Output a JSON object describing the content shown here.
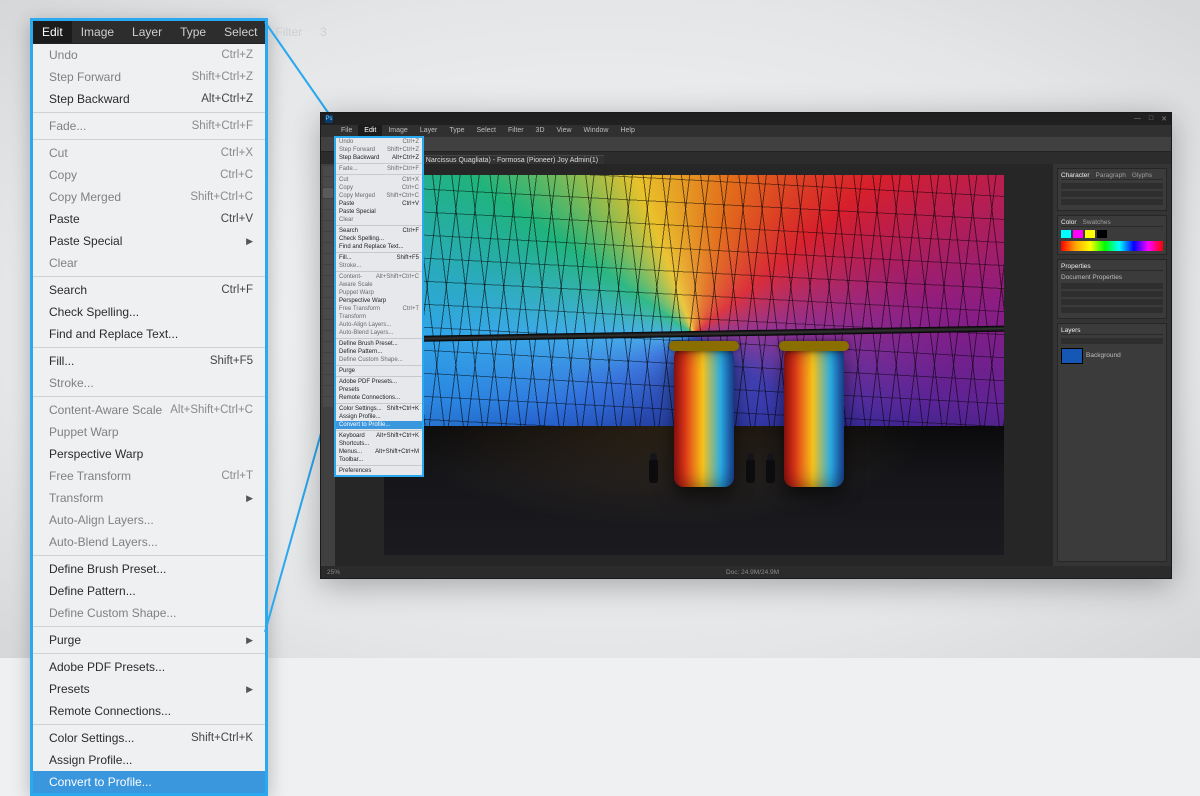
{
  "zoom_menubar": [
    "Edit",
    "Image",
    "Layer",
    "Type",
    "Select",
    "Filter",
    "3"
  ],
  "zoom_menu_active": 0,
  "menu_groups": [
    [
      {
        "label": "Undo",
        "shortcut": "Ctrl+Z",
        "enabled": false
      },
      {
        "label": "Step Forward",
        "shortcut": "Shift+Ctrl+Z",
        "enabled": false
      },
      {
        "label": "Step Backward",
        "shortcut": "Alt+Ctrl+Z",
        "enabled": true
      }
    ],
    [
      {
        "label": "Fade...",
        "shortcut": "Shift+Ctrl+F",
        "enabled": false
      }
    ],
    [
      {
        "label": "Cut",
        "shortcut": "Ctrl+X",
        "enabled": false
      },
      {
        "label": "Copy",
        "shortcut": "Ctrl+C",
        "enabled": false
      },
      {
        "label": "Copy Merged",
        "shortcut": "Shift+Ctrl+C",
        "enabled": false
      },
      {
        "label": "Paste",
        "shortcut": "Ctrl+V",
        "enabled": true
      },
      {
        "label": "Paste Special",
        "submenu": true,
        "enabled": true
      },
      {
        "label": "Clear",
        "enabled": false
      }
    ],
    [
      {
        "label": "Search",
        "shortcut": "Ctrl+F",
        "enabled": true
      },
      {
        "label": "Check Spelling...",
        "enabled": true
      },
      {
        "label": "Find and Replace Text...",
        "enabled": true
      }
    ],
    [
      {
        "label": "Fill...",
        "shortcut": "Shift+F5",
        "enabled": true
      },
      {
        "label": "Stroke...",
        "enabled": false
      }
    ],
    [
      {
        "label": "Content-Aware Scale",
        "shortcut": "Alt+Shift+Ctrl+C",
        "enabled": false
      },
      {
        "label": "Puppet Warp",
        "enabled": false
      },
      {
        "label": "Perspective Warp",
        "enabled": true
      },
      {
        "label": "Free Transform",
        "shortcut": "Ctrl+T",
        "enabled": false
      },
      {
        "label": "Transform",
        "submenu": true,
        "enabled": false
      },
      {
        "label": "Auto-Align Layers...",
        "enabled": false
      },
      {
        "label": "Auto-Blend Layers...",
        "enabled": false
      }
    ],
    [
      {
        "label": "Define Brush Preset...",
        "enabled": true
      },
      {
        "label": "Define Pattern...",
        "enabled": true
      },
      {
        "label": "Define Custom Shape...",
        "enabled": false
      }
    ],
    [
      {
        "label": "Purge",
        "submenu": true,
        "enabled": true
      }
    ],
    [
      {
        "label": "Adobe PDF Presets...",
        "enabled": true
      },
      {
        "label": "Presets",
        "submenu": true,
        "enabled": true
      },
      {
        "label": "Remote Connections...",
        "enabled": true
      }
    ],
    [
      {
        "label": "Color Settings...",
        "shortcut": "Shift+Ctrl+K",
        "enabled": true
      },
      {
        "label": "Assign Profile...",
        "enabled": true
      },
      {
        "label": "Convert to Profile...",
        "enabled": true,
        "highlight": true
      }
    ]
  ],
  "ps": {
    "menubar": [
      "File",
      "Edit",
      "Image",
      "Layer",
      "Type",
      "Select",
      "Filter",
      "3D",
      "View",
      "Window",
      "Help"
    ],
    "open_menu_index": 1,
    "document_tab": "Dome of Light (Glass artist Narcissus Quagliata) - Formosa (Pioneer) Joy Admin(1)",
    "status_left": "25%",
    "status_center": "Doc: 24.9M/24.9M",
    "panels": {
      "color_tabs": [
        "Character",
        "Paragraph",
        "Glyphs"
      ],
      "swatch_tabs": [
        "Color",
        "Swatches"
      ],
      "prop_tabs": [
        "Properties"
      ],
      "prop_title": "Document Properties",
      "layers_tabs": [
        "Layers"
      ],
      "layer_name": "Background"
    },
    "small_menu_groups": [
      [
        {
          "label": "Undo",
          "shortcut": "Ctrl+Z",
          "enabled": false
        },
        {
          "label": "Step Forward",
          "shortcut": "Shift+Ctrl+Z",
          "enabled": false
        },
        {
          "label": "Step Backward",
          "shortcut": "Alt+Ctrl+Z",
          "enabled": true
        }
      ],
      [
        {
          "label": "Fade...",
          "shortcut": "Shift+Ctrl+F",
          "enabled": false
        }
      ],
      [
        {
          "label": "Cut",
          "shortcut": "Ctrl+X",
          "enabled": false
        },
        {
          "label": "Copy",
          "shortcut": "Ctrl+C",
          "enabled": false
        },
        {
          "label": "Copy Merged",
          "shortcut": "Shift+Ctrl+C",
          "enabled": false
        },
        {
          "label": "Paste",
          "shortcut": "Ctrl+V",
          "enabled": true
        },
        {
          "label": "Paste Special",
          "enabled": true
        },
        {
          "label": "Clear",
          "enabled": false
        }
      ],
      [
        {
          "label": "Search",
          "shortcut": "Ctrl+F",
          "enabled": true
        },
        {
          "label": "Check Spelling...",
          "enabled": true
        },
        {
          "label": "Find and Replace Text...",
          "enabled": true
        }
      ],
      [
        {
          "label": "Fill...",
          "shortcut": "Shift+F5",
          "enabled": true
        },
        {
          "label": "Stroke...",
          "enabled": false
        }
      ],
      [
        {
          "label": "Content-Aware Scale",
          "shortcut": "Alt+Shift+Ctrl+C",
          "enabled": false
        },
        {
          "label": "Puppet Warp",
          "enabled": false
        },
        {
          "label": "Perspective Warp",
          "enabled": true
        },
        {
          "label": "Free Transform",
          "shortcut": "Ctrl+T",
          "enabled": false
        },
        {
          "label": "Transform",
          "enabled": false
        },
        {
          "label": "Auto-Align Layers...",
          "enabled": false
        },
        {
          "label": "Auto-Blend Layers...",
          "enabled": false
        }
      ],
      [
        {
          "label": "Define Brush Preset...",
          "enabled": true
        },
        {
          "label": "Define Pattern...",
          "enabled": true
        },
        {
          "label": "Define Custom Shape...",
          "enabled": false
        }
      ],
      [
        {
          "label": "Purge",
          "enabled": true
        }
      ],
      [
        {
          "label": "Adobe PDF Presets...",
          "enabled": true
        },
        {
          "label": "Presets",
          "enabled": true
        },
        {
          "label": "Remote Connections...",
          "enabled": true
        }
      ],
      [
        {
          "label": "Color Settings...",
          "shortcut": "Shift+Ctrl+K",
          "enabled": true
        },
        {
          "label": "Assign Profile...",
          "enabled": true
        },
        {
          "label": "Convert to Profile...",
          "enabled": true,
          "highlight": true
        }
      ],
      [
        {
          "label": "Keyboard Shortcuts...",
          "shortcut": "Alt+Shift+Ctrl+K",
          "enabled": true
        },
        {
          "label": "Menus...",
          "shortcut": "Alt+Shift+Ctrl+M",
          "enabled": true
        },
        {
          "label": "Toolbar...",
          "enabled": true
        }
      ],
      [
        {
          "label": "Preferences",
          "enabled": true
        }
      ]
    ]
  }
}
